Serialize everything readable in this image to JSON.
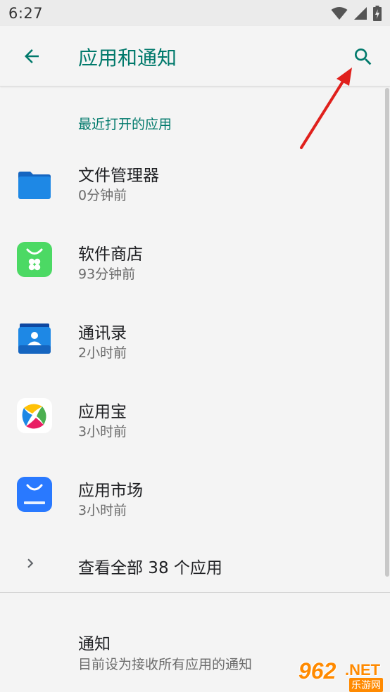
{
  "status_bar": {
    "time": "6:27"
  },
  "app_bar": {
    "title": "应用和通知"
  },
  "recent": {
    "header": "最近打开的应用",
    "apps": [
      {
        "name": "文件管理器",
        "time": "0分钟前",
        "icon": "folder-icon"
      },
      {
        "name": "软件商店",
        "time": "93分钟前",
        "icon": "app-store-icon"
      },
      {
        "name": "通讯录",
        "time": "2小时前",
        "icon": "contacts-icon"
      },
      {
        "name": "应用宝",
        "time": "3小时前",
        "icon": "yingyongbao-icon"
      },
      {
        "name": "应用市场",
        "time": "3小时前",
        "icon": "honor-market-icon"
      }
    ]
  },
  "see_all": {
    "label": "查看全部 38 个应用"
  },
  "notifications": {
    "title": "通知",
    "summary": "目前设为接收所有应用的通知"
  },
  "watermark": {
    "number": "962",
    "suffix": ".NET",
    "text": "乐游网"
  },
  "colors": {
    "accent": "#00796b",
    "annotation": "#e0201c"
  }
}
